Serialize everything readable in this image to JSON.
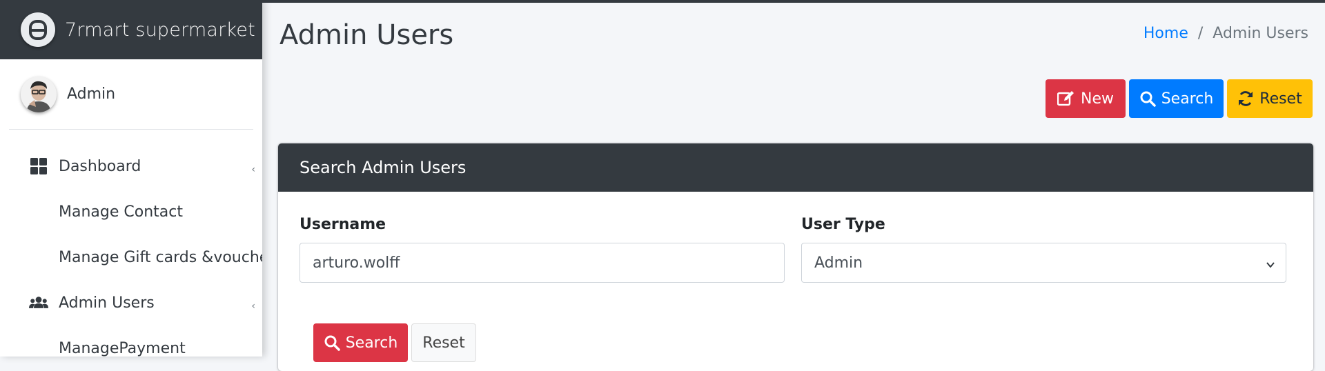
{
  "brand": {
    "name": "7rmart supermarket",
    "logo_icon": "brand-logo-icon"
  },
  "user": {
    "name": "Admin"
  },
  "sidebar": {
    "items": [
      {
        "label": "Dashboard",
        "icon": "dashboard-icon"
      },
      {
        "label": "Manage Contact"
      },
      {
        "label": "Manage Gift cards &voucher"
      },
      {
        "label": "Admin Users",
        "icon": "users-icon"
      },
      {
        "label": "ManagePayment"
      }
    ]
  },
  "header": {
    "title": "Admin Users",
    "breadcrumb": {
      "home": "Home",
      "separator": "/",
      "current": "Admin Users"
    }
  },
  "toolbar": {
    "new_label": "New",
    "search_label": "Search",
    "reset_label": "Reset"
  },
  "search_card": {
    "title": "Search Admin Users",
    "username_label": "Username",
    "username_value": "arturo.wolff",
    "usertype_label": "User Type",
    "usertype_value": "Admin",
    "search_label": "Search",
    "reset_label": "Reset"
  },
  "colors": {
    "sidebar_dark": "#343a40",
    "primary": "#007bff",
    "danger": "#dc3545",
    "warning": "#ffc107"
  }
}
